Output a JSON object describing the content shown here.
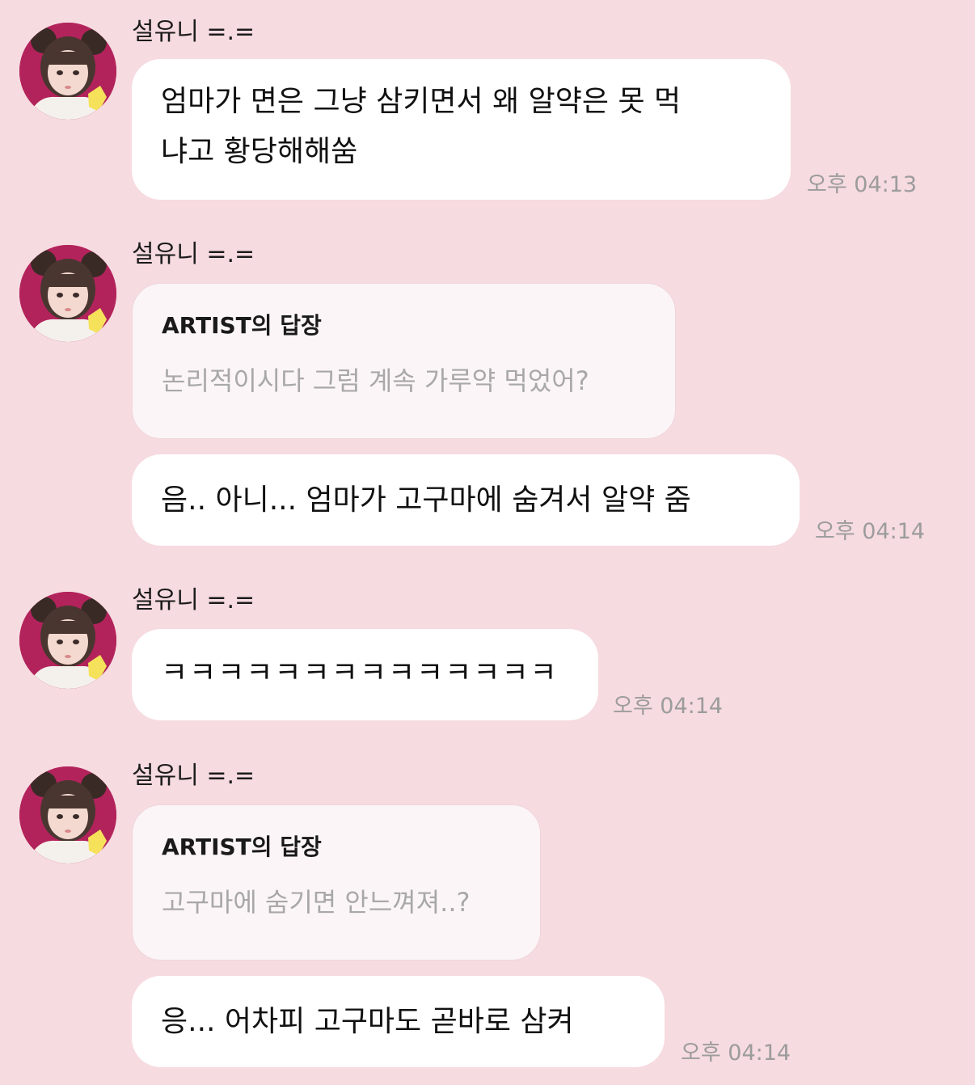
{
  "groups": [
    {
      "sender": "설유니 =.=",
      "messages": [
        {
          "lines": [
            "엄마가 면은 그냥 삼키면서 왜 알약은 못 먹",
            "냐고 황당해해쑴"
          ],
          "time": "오후 04:13"
        }
      ]
    },
    {
      "sender": "설유니 =.=",
      "reply": {
        "title": "ARTIST의 답장",
        "quote": "논리적이시다 그럼 계속 가루약 먹었어?"
      },
      "messages": [
        {
          "lines": [
            "음.. 아니... 엄마가 고구마에 숨겨서 알약 줌"
          ],
          "time": "오후 04:14"
        }
      ]
    },
    {
      "sender": "설유니 =.=",
      "messages": [
        {
          "lines": [
            "ㅋㅋㅋㅋㅋㅋㅋㅋㅋㅋㅋㅋㅋㅋ"
          ],
          "time": "오후 04:14"
        }
      ]
    },
    {
      "sender": "설유니 =.=",
      "reply": {
        "title": "ARTIST의 답장",
        "quote": "고구마에 숨기면 안느껴져..?"
      },
      "messages": [
        {
          "lines": [
            "응... 어차피 고구마도 곧바로 삼켜"
          ],
          "time": "오후 04:14"
        }
      ]
    }
  ],
  "colors": {
    "background": "#f6dbe0",
    "bubble": "#ffffff",
    "reply_bubble": "#fcf5f7",
    "timestamp": "#9c9c9c",
    "reply_quote": "#a8a8a8"
  }
}
